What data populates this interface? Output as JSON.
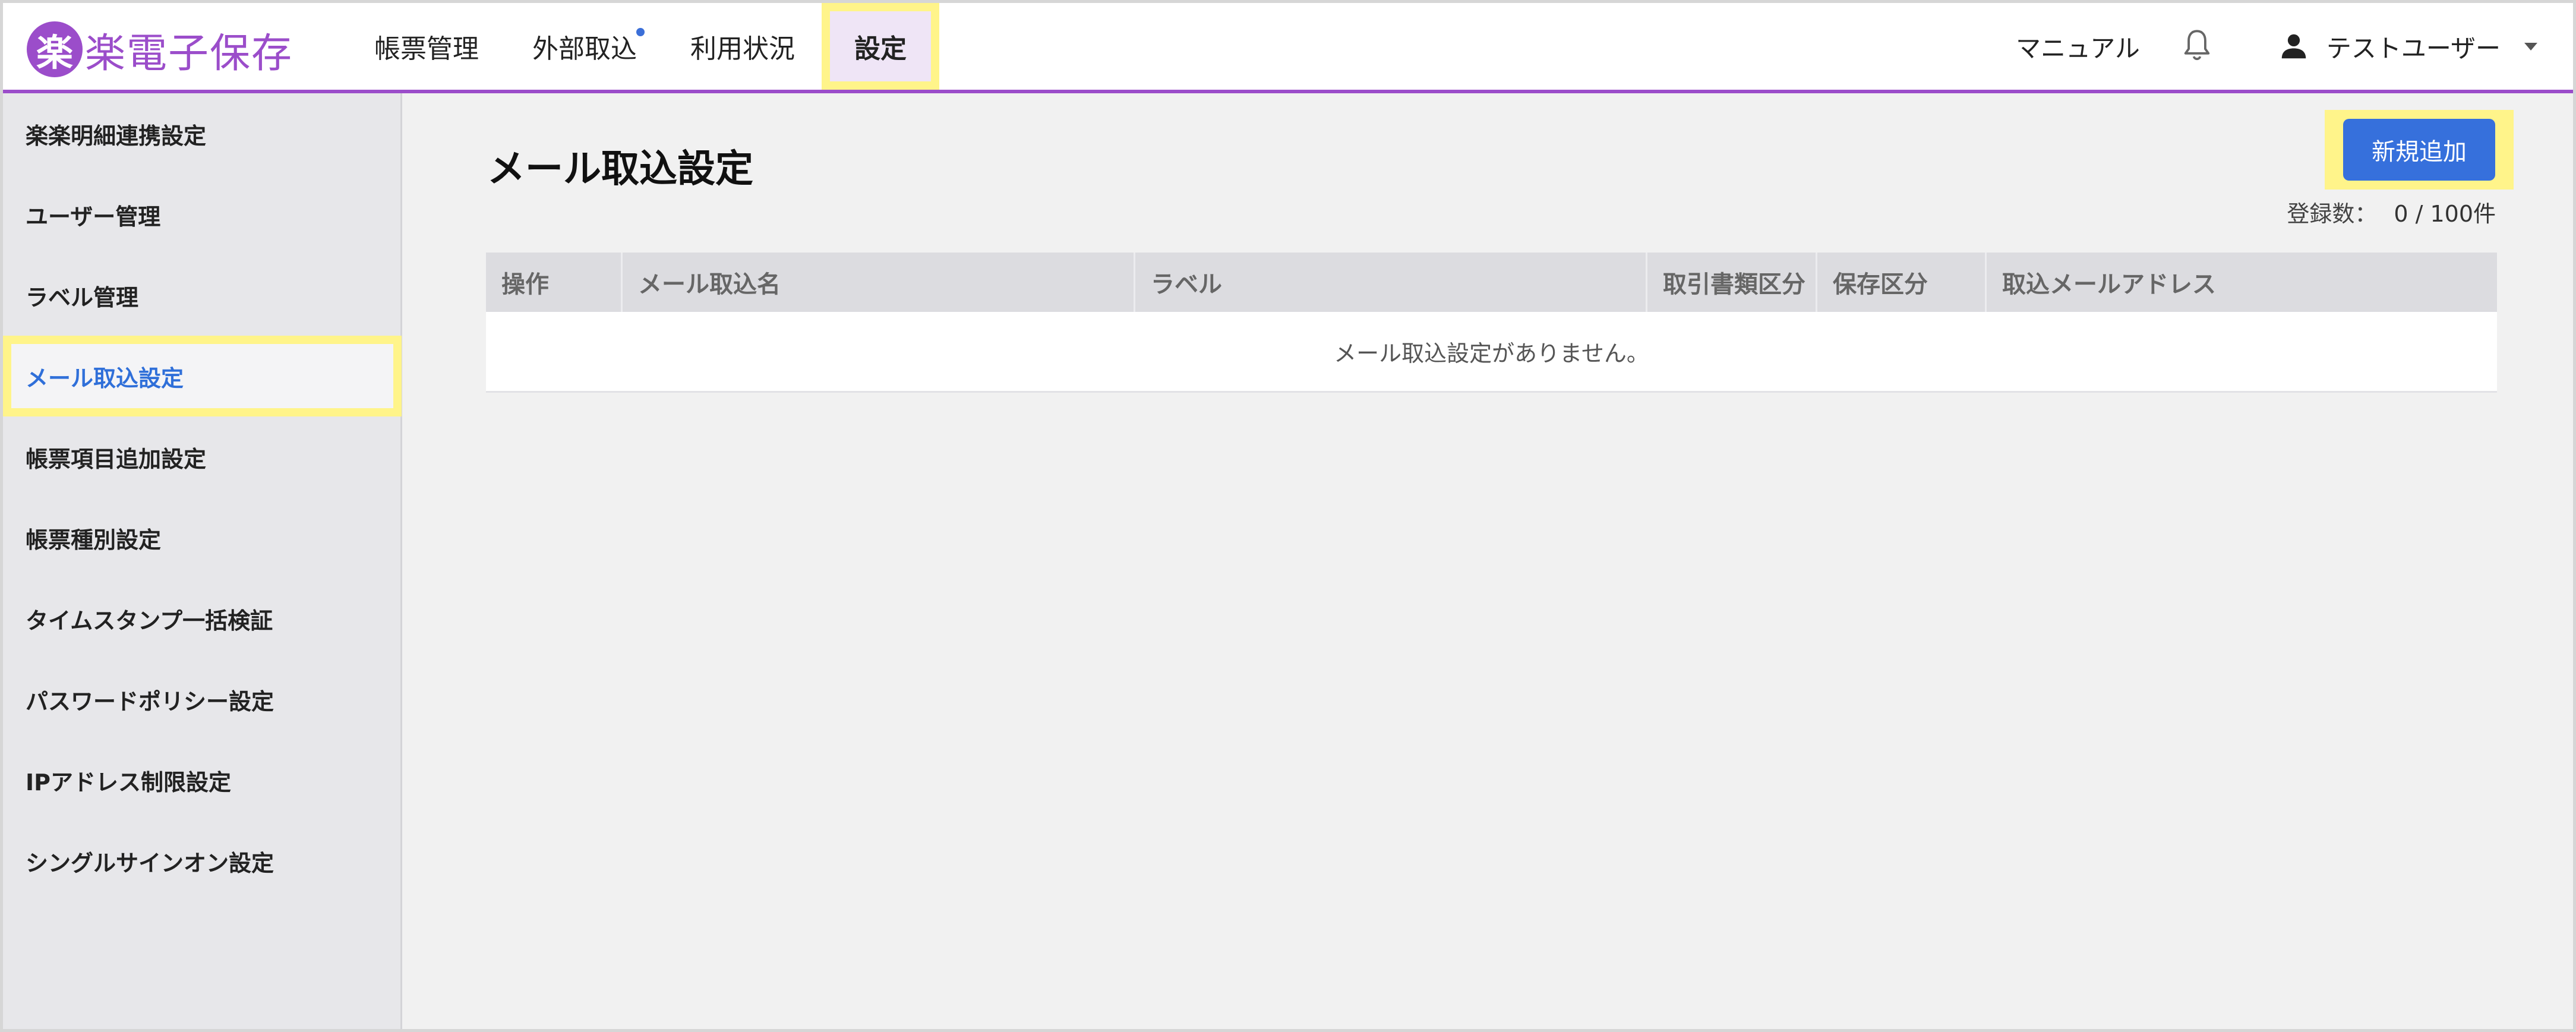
{
  "app": {
    "logo_mark": "楽",
    "logo_text": "楽電子保存",
    "brand_color": "#9b4dca",
    "accent_color": "#3670dc",
    "highlight_color": "#fff48a"
  },
  "header": {
    "nav": [
      {
        "label": "帳票管理"
      },
      {
        "label": "外部取込",
        "has_notification_dot": true
      },
      {
        "label": "利用状況"
      },
      {
        "label": "設定",
        "active": true
      }
    ],
    "manual_label": "マニュアル",
    "bell_icon": "bell-icon",
    "user_icon": "person-icon",
    "user_name": "テストユーザー"
  },
  "sidebar": {
    "items": [
      {
        "label": "楽楽明細連携設定"
      },
      {
        "label": "ユーザー管理"
      },
      {
        "label": "ラベル管理"
      },
      {
        "label": "メール取込設定",
        "active": true
      },
      {
        "label": "帳票項目追加設定"
      },
      {
        "label": "帳票種別設定"
      },
      {
        "label": "タイムスタンプ一括検証"
      },
      {
        "label": "パスワードポリシー設定"
      },
      {
        "label": "IPアドレス制限設定"
      },
      {
        "label": "シングルサインオン設定"
      }
    ]
  },
  "main": {
    "title": "メール取込設定",
    "add_button_label": "新規追加",
    "count_label": "登録数：",
    "count_value": "0 / 100件",
    "table": {
      "columns": [
        "操作",
        "メール取込名",
        "ラベル",
        "取引書類区分",
        "保存区分",
        "取込メールアドレス"
      ],
      "empty_message": "メール取込設定がありません。"
    }
  }
}
